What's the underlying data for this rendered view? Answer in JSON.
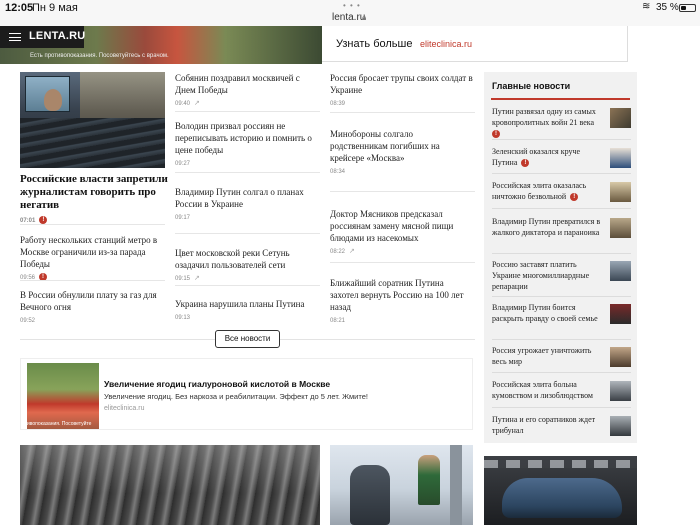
{
  "status_bar": {
    "time": "12:05",
    "date": "Пн 9 мая",
    "url": "lenta.ru",
    "battery": "35 %",
    "battery_level": 0.35
  },
  "site": {
    "logo": "LENTA.RU"
  },
  "top_ad": {
    "disclaimer": "Есть противопоказания. Посоветуйтесь с врачом.",
    "learn_more": "Узнать больше",
    "domain": "eliteclinica.ru"
  },
  "lead": {
    "title": "Российские власти запретили журналистам говорить про негатив",
    "time": "07:01"
  },
  "col1": [
    {
      "title": "Работу нескольких станций метро в Москве ограничили из-за парада Победы",
      "time": "09:56"
    },
    {
      "title": "В России обнулили плату за газ для Вечного огня",
      "time": "09:52"
    }
  ],
  "col2": [
    {
      "title": "Собянин поздравил москвичей с Днем Победы",
      "time": "09:40"
    },
    {
      "title": "Володин призвал россиян не переписывать историю и помнить о цене победы",
      "time": "09:27"
    },
    {
      "title": "Владимир Путин солгал о планах России в Украине",
      "time": "09:17"
    },
    {
      "title": "Цвет московской реки Сетунь озадачил пользователей сети",
      "time": "09:15"
    },
    {
      "title": "Украина нарушила планы Путина",
      "time": "09:13"
    }
  ],
  "col3": [
    {
      "title": "Россия бросает трупы своих солдат в Украине",
      "time": "08:39"
    },
    {
      "title": "Минобороны солгало родственникам погибших на крейсере «Москва»",
      "time": "08:34"
    },
    {
      "title": "Доктор Мясников предсказал россиянам замену мясной пищи блюдами из насекомых",
      "time": "08:22"
    },
    {
      "title": "Ближайший соратник Путина захотел вернуть Россию на 100 лет назад",
      "time": "08:21"
    }
  ],
  "all_news_label": "Все новости",
  "ad_block": {
    "title": "Увеличение ягодиц гиалуроновой кислотой в Москве",
    "description": "Увеличение ягодиц. Без наркоза и реабилитации. Эффект до 5 лет. Жмите!",
    "domain": "eliteclinica.ru",
    "image_caption": "ивопоказания. Посоветуйте"
  },
  "sidebar": {
    "heading": "Главные новости",
    "items": [
      {
        "title": "Путин развязал одну из самых кровопролитных войн 21 века"
      },
      {
        "title": "Зеленский оказался круче Путина"
      },
      {
        "title": "Российская элита оказалась ничтожно безвольной"
      },
      {
        "title": "Владимир Путин превратился в жалкого диктатора и параноика"
      },
      {
        "title": "Россию заставят платить Украине многомиллиардные репарации"
      },
      {
        "title": "Владимир Путин боится раскрыть правду о своей семье"
      },
      {
        "title": "Россия угрожает уничтожить весь мир"
      },
      {
        "title": "Российская элита больна кумовством и лизоблюдством"
      },
      {
        "title": "Путина и его соратников ждет трибунал"
      }
    ]
  },
  "colors": {
    "accent": "#c0392b",
    "sidebar_bg": "#f1f1f1",
    "text": "#222222"
  }
}
